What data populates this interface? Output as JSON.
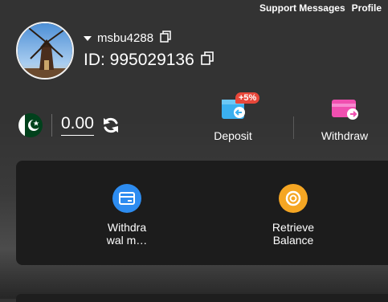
{
  "top_links": {
    "support": "Support Messages",
    "profile": "Profile"
  },
  "user": {
    "username": "msbu4288",
    "id_text": "ID: 995029136"
  },
  "wallet": {
    "balance": "0.00",
    "country_flag": "pakistan-flag"
  },
  "actions": {
    "deposit": {
      "label": "Deposit",
      "bonus": "+5%"
    },
    "withdraw": {
      "label": "Withdraw"
    }
  },
  "panel": {
    "items": [
      {
        "label_line1": "Withdra",
        "label_line2": "wal m…",
        "icon": "card-icon",
        "color": "#2d8cf0"
      },
      {
        "label_line1": "Retrieve",
        "label_line2": "Balance",
        "icon": "search-icon",
        "color": "#f5a623"
      }
    ]
  },
  "colors": {
    "badge": "#e8473a",
    "deposit_icon": "#3bb0f0",
    "withdraw_icon": "#f04fb0"
  }
}
